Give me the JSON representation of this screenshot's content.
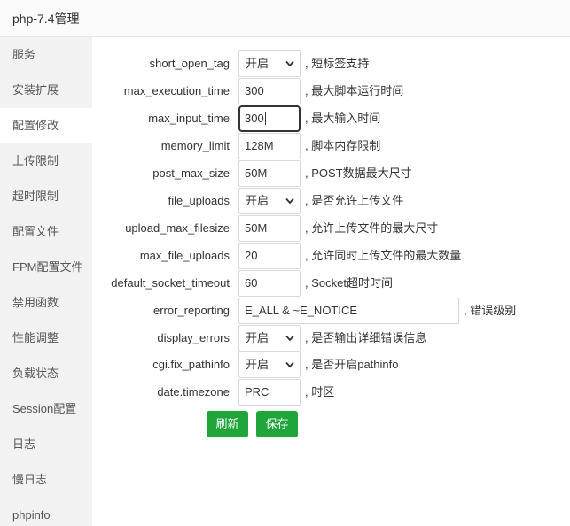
{
  "window": {
    "title": "php-7.4管理"
  },
  "sidebar": {
    "items": [
      {
        "label": "服务"
      },
      {
        "label": "安装扩展"
      },
      {
        "label": "配置修改"
      },
      {
        "label": "上传限制"
      },
      {
        "label": "超时限制"
      },
      {
        "label": "配置文件"
      },
      {
        "label": "FPM配置文件"
      },
      {
        "label": "禁用函数"
      },
      {
        "label": "性能调整"
      },
      {
        "label": "负载状态"
      },
      {
        "label": "Session配置"
      },
      {
        "label": "日志"
      },
      {
        "label": "慢日志"
      },
      {
        "label": "phpinfo"
      }
    ],
    "active_index": 2
  },
  "settings": [
    {
      "key": "short_open_tag",
      "type": "select",
      "value": "开启",
      "hint": ", 短标签支持"
    },
    {
      "key": "max_execution_time",
      "type": "input",
      "value": "300",
      "hint": ", 最大脚本运行时间"
    },
    {
      "key": "max_input_time",
      "type": "input",
      "value": "300",
      "hint": ", 最大输入时间",
      "focused": true
    },
    {
      "key": "memory_limit",
      "type": "input",
      "value": "128M",
      "hint": ", 脚本内存限制"
    },
    {
      "key": "post_max_size",
      "type": "input",
      "value": "50M",
      "hint": ", POST数据最大尺寸"
    },
    {
      "key": "file_uploads",
      "type": "select",
      "value": "开启",
      "hint": ", 是否允许上传文件"
    },
    {
      "key": "upload_max_filesize",
      "type": "input",
      "value": "50M",
      "hint": ", 允许上传文件的最大尺寸"
    },
    {
      "key": "max_file_uploads",
      "type": "input",
      "value": "20",
      "hint": ", 允许同时上传文件的最大数量"
    },
    {
      "key": "default_socket_timeout",
      "type": "input",
      "value": "60",
      "hint": ", Socket超时时间"
    },
    {
      "key": "error_reporting",
      "type": "input-wide",
      "value": "E_ALL & ~E_NOTICE",
      "hint": ", 错误级别"
    },
    {
      "key": "display_errors",
      "type": "select",
      "value": "开启",
      "hint": ", 是否输出详细错误信息"
    },
    {
      "key": "cgi.fix_pathinfo",
      "type": "select",
      "value": "开启",
      "hint": ", 是否开启pathinfo"
    },
    {
      "key": "date.timezone",
      "type": "input",
      "value": "PRC",
      "hint": ", 时区"
    }
  ],
  "buttons": {
    "refresh_label": "刷新",
    "save_label": "保存"
  },
  "colors": {
    "accent": "#20a53a",
    "sidebar_bg": "#f2f2f2"
  }
}
